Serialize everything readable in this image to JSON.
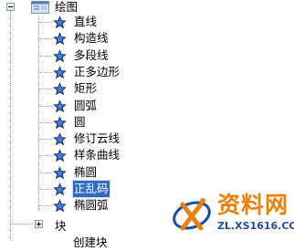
{
  "tree": {
    "root": {
      "label": "绘图",
      "expanded": true
    },
    "items": [
      {
        "label": "直线",
        "icon": "star-icon"
      },
      {
        "label": "构造线",
        "icon": "star-icon"
      },
      {
        "label": "多段线",
        "icon": "star-icon"
      },
      {
        "label": "正多边形",
        "icon": "star-icon"
      },
      {
        "label": "矩形",
        "icon": "star-icon"
      },
      {
        "label": "圆弧",
        "icon": "star-icon"
      },
      {
        "label": "圆",
        "icon": "star-icon"
      },
      {
        "label": "修订云线",
        "icon": "star-icon"
      },
      {
        "label": "样条曲线",
        "icon": "star-icon"
      },
      {
        "label": "椭圆",
        "icon": "star-icon"
      },
      {
        "label": "正乱码",
        "icon": "star-icon",
        "selected": true
      },
      {
        "label": "椭圆弧",
        "icon": "star-icon"
      }
    ],
    "block": {
      "label": "块",
      "expanded": false
    },
    "next_partial": {
      "label": "创建块"
    }
  },
  "watermark": {
    "title": "资料网",
    "url": "ZL.XS1616.COM"
  },
  "colors": {
    "selection": "#316ac5",
    "star": "#1f4fa3",
    "watermark_orange": "#e8820c",
    "watermark_blue": "#1c4fa1"
  }
}
